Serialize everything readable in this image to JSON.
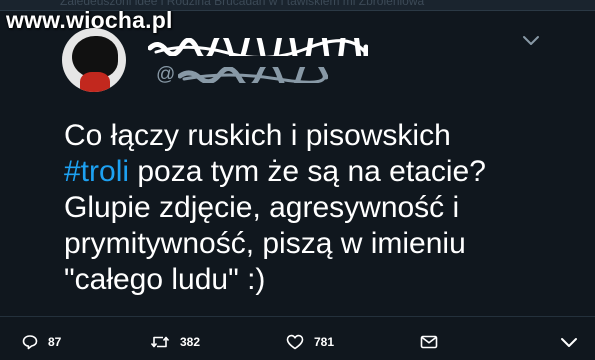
{
  "watermark": "www.wiocha.pl",
  "header": {
    "ghost_text": "Zaledeuszoni idee i Rodzina Brucadan w i tawiskiem mi Zbroleniowa",
    "handle_prefix": "@"
  },
  "tweet": {
    "line1": "Co łączy ruskich i pisowskich",
    "hashtag": "#troli",
    "line2_rest": " poza tym że są na etacie?",
    "line3": "Glupie zdjęcie, agresywność i",
    "line4": "prymitywność, piszą w imieniu",
    "line5": "\"całego ludu\" :)"
  },
  "actions": {
    "replies": "87",
    "retweets": "382",
    "likes": "781"
  },
  "icons": [
    "reply-icon",
    "retweet-icon",
    "heart-icon",
    "mail-icon",
    "chevron-down-icon"
  ],
  "colors": {
    "background": "#10171e",
    "text": "#ffffff",
    "hashtag": "#1da1f2",
    "muted": "#8899a6"
  }
}
